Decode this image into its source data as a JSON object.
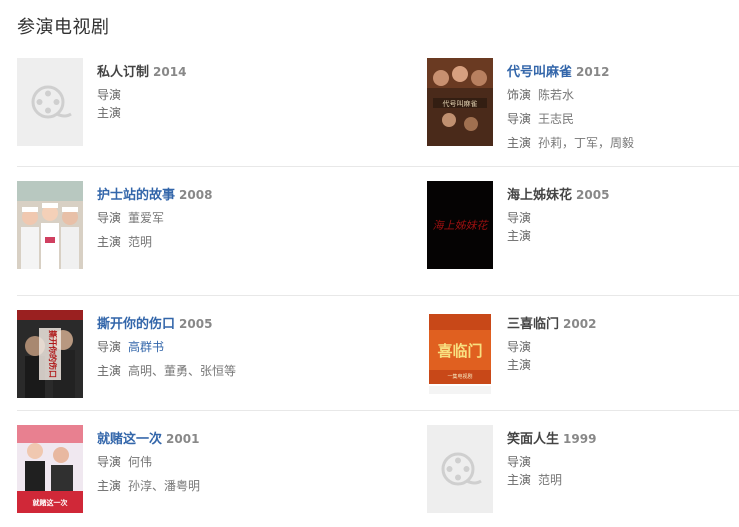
{
  "section": {
    "title": "参演电视剧"
  },
  "works": [
    {
      "title": "私人订制",
      "year": "2014",
      "title_link": false,
      "poster": "placeholder",
      "lines": [
        {
          "label": "导演",
          "value": ""
        },
        {
          "label": "主演",
          "value": ""
        }
      ]
    },
    {
      "title": "代号叫麻雀",
      "year": "2012",
      "title_link": true,
      "poster": "image",
      "lines": [
        {
          "label": "饰演",
          "value": "陈若水"
        },
        {
          "label": "导演",
          "value": "王志民"
        },
        {
          "label": "主演",
          "value": "孙莉，丁军，周毅"
        }
      ]
    },
    {
      "title": "护士站的故事",
      "year": "2008",
      "title_link": true,
      "poster": "image",
      "lines": [
        {
          "label": "导演",
          "value": "董爱军"
        },
        {
          "label": "主演",
          "value": "范明"
        }
      ]
    },
    {
      "title": "海上姊妹花",
      "year": "2005",
      "title_link": false,
      "poster": "image",
      "lines": [
        {
          "label": "导演",
          "value": ""
        },
        {
          "label": "主演",
          "value": ""
        }
      ]
    },
    {
      "title": "撕开你的伤口",
      "year": "2005",
      "title_link": true,
      "poster": "image",
      "lines": [
        {
          "label": "导演",
          "value": "高群书",
          "link": true
        },
        {
          "label": "主演",
          "value": "高明、董勇、张恒等"
        }
      ]
    },
    {
      "title": "三喜临门",
      "year": "2002",
      "title_link": false,
      "poster": "image",
      "lines": [
        {
          "label": "导演",
          "value": ""
        },
        {
          "label": "主演",
          "value": ""
        }
      ]
    },
    {
      "title": "就赌这一次",
      "year": "2001",
      "title_link": true,
      "poster": "image",
      "lines": [
        {
          "label": "导演",
          "value": "何伟"
        },
        {
          "label": "主演",
          "value": "孙淳、潘粤明"
        }
      ]
    },
    {
      "title": "笑面人生",
      "year": "1999",
      "title_link": false,
      "poster": "placeholder",
      "lines": [
        {
          "label": "导演",
          "value": ""
        },
        {
          "label": "主演",
          "value": "范明"
        }
      ]
    }
  ],
  "posters": {
    "daihao": "代号叫麻雀",
    "haishang": "海上姊妹花",
    "sikai": "撕开你的伤口",
    "sanxi": "喜临门",
    "sanxi_sub": "一集电视剧",
    "jiudu": "就赌这一次"
  }
}
